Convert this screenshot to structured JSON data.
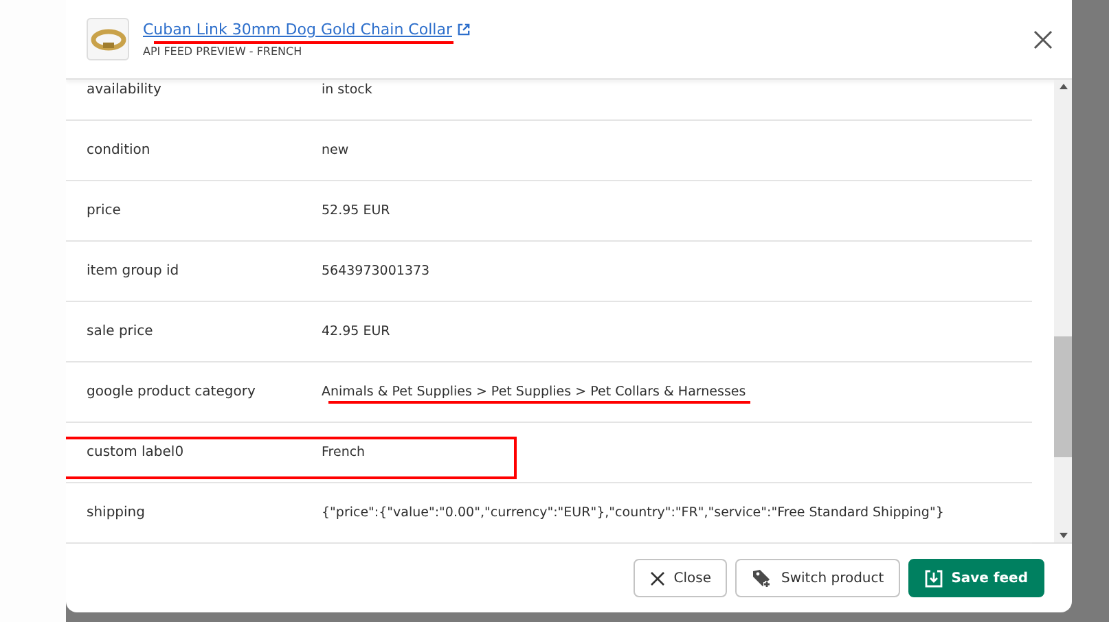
{
  "dialog": {
    "title": "Cuban Link 30mm Dog Gold Chain Collar",
    "subtitle": "API FEED PREVIEW - FRENCH",
    "title_redacted": true
  },
  "attributes": [
    {
      "label": "availability",
      "value": "in stock",
      "highlighted": false,
      "redacted": false
    },
    {
      "label": "condition",
      "value": "new",
      "highlighted": false,
      "redacted": false
    },
    {
      "label": "price",
      "value": "52.95 EUR",
      "highlighted": false,
      "redacted": false
    },
    {
      "label": "item group id",
      "value": "5643973001373",
      "highlighted": false,
      "redacted": false
    },
    {
      "label": "sale price",
      "value": "42.95 EUR",
      "highlighted": false,
      "redacted": false
    },
    {
      "label": "google product category",
      "value": "Animals & Pet Supplies > Pet Supplies > Pet Collars & Harnesses",
      "highlighted": false,
      "redacted": true
    },
    {
      "label": "custom label0",
      "value": "French",
      "highlighted": true,
      "redacted": false
    },
    {
      "label": "shipping",
      "value": "{\"price\":{\"value\":\"0.00\",\"currency\":\"EUR\"},\"country\":\"FR\",\"service\":\"Free Standard Shipping\"}",
      "highlighted": false,
      "redacted": false
    }
  ],
  "buttons": [
    {
      "label": "Close",
      "kind": "close"
    },
    {
      "label": "Switch product",
      "kind": "switch"
    },
    {
      "label": "Save feed",
      "kind": "save"
    }
  ]
}
